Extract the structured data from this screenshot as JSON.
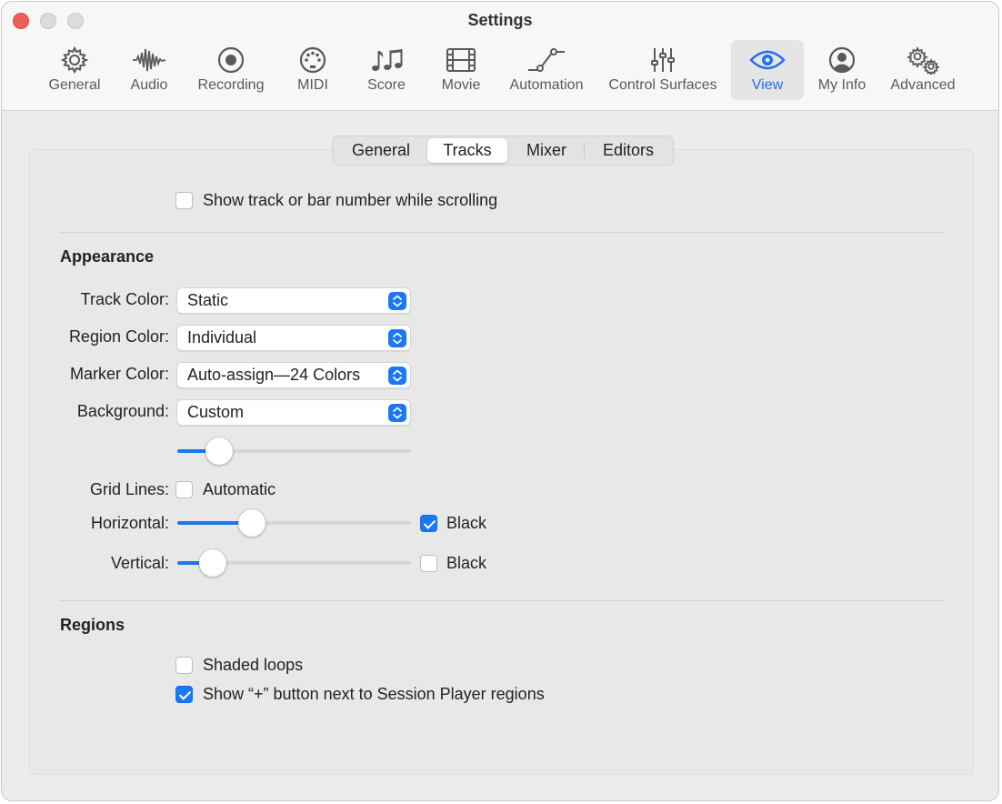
{
  "window": {
    "title": "Settings"
  },
  "toolbar": {
    "items": [
      {
        "label": "General",
        "icon": "gear-icon"
      },
      {
        "label": "Audio",
        "icon": "waveform-icon"
      },
      {
        "label": "Recording",
        "icon": "record-icon"
      },
      {
        "label": "MIDI",
        "icon": "midi-port-icon"
      },
      {
        "label": "Score",
        "icon": "music-notes-icon"
      },
      {
        "label": "Movie",
        "icon": "film-icon"
      },
      {
        "label": "Automation",
        "icon": "automation-curve-icon"
      },
      {
        "label": "Control Surfaces",
        "icon": "sliders-icon"
      },
      {
        "label": "View",
        "icon": "eye-icon"
      },
      {
        "label": "My Info",
        "icon": "person-circle-icon"
      },
      {
        "label": "Advanced",
        "icon": "gears-icon"
      }
    ],
    "selected": "View"
  },
  "tabs": {
    "items": [
      "General",
      "Tracks",
      "Mixer",
      "Editors"
    ],
    "selected": "Tracks"
  },
  "top_option": {
    "label": "Show track or bar number while scrolling",
    "checked": false
  },
  "appearance": {
    "heading": "Appearance",
    "track_color": {
      "label": "Track Color:",
      "value": "Static"
    },
    "region_color": {
      "label": "Region Color:",
      "value": "Individual"
    },
    "marker_color": {
      "label": "Marker Color:",
      "value": "Auto-assign—24 Colors"
    },
    "background": {
      "label": "Background:",
      "value": "Custom",
      "slider_level": 0.18
    },
    "grid_lines": {
      "label": "Grid Lines:",
      "option_label": "Automatic",
      "checked": false
    },
    "horizontal": {
      "label": "Horizontal:",
      "slider_level": 0.32,
      "black_label": "Black",
      "black_checked": true
    },
    "vertical": {
      "label": "Vertical:",
      "slider_level": 0.15,
      "black_label": "Black",
      "black_checked": false
    }
  },
  "regions": {
    "heading": "Regions",
    "shaded_loops": {
      "label": "Shaded loops",
      "checked": false
    },
    "show_plus": {
      "label": "Show “+” button next to Session Player regions",
      "checked": true
    }
  },
  "colors": {
    "accent": "#1a78f4",
    "close": "#ec5f58"
  }
}
